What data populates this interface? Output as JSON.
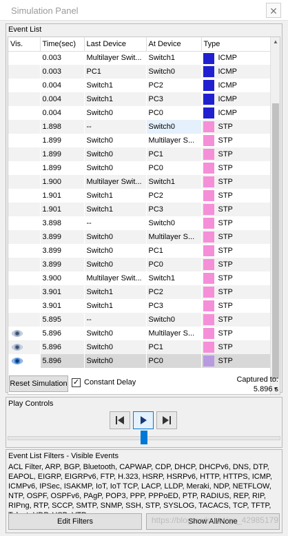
{
  "window": {
    "title": "Simulation Panel",
    "close_label": "✕"
  },
  "event_list": {
    "section_label": "Event List",
    "columns": [
      "Vis.",
      "Time(sec)",
      "Last Device",
      "At Device",
      "Type"
    ],
    "rows": [
      {
        "vis": "",
        "time": "0.003",
        "last": "Multilayer Swit...",
        "at": "Switch1",
        "type": "ICMP",
        "color": "#2020d0"
      },
      {
        "vis": "",
        "time": "0.003",
        "last": "PC1",
        "at": "Switch0",
        "type": "ICMP",
        "color": "#2020d0"
      },
      {
        "vis": "",
        "time": "0.004",
        "last": "Switch1",
        "at": "PC2",
        "type": "ICMP",
        "color": "#2020d0"
      },
      {
        "vis": "",
        "time": "0.004",
        "last": "Switch1",
        "at": "PC3",
        "type": "ICMP",
        "color": "#2020d0"
      },
      {
        "vis": "",
        "time": "0.004",
        "last": "Switch0",
        "at": "PC0",
        "type": "ICMP",
        "color": "#2020d0"
      },
      {
        "vis": "",
        "time": "1.898",
        "last": "--",
        "at": "Switch0",
        "type": "STP",
        "color": "#f58fd8"
      },
      {
        "vis": "",
        "time": "1.899",
        "last": "Switch0",
        "at": "Multilayer S...",
        "type": "STP",
        "color": "#f58fd8"
      },
      {
        "vis": "",
        "time": "1.899",
        "last": "Switch0",
        "at": "PC1",
        "type": "STP",
        "color": "#f58fd8"
      },
      {
        "vis": "",
        "time": "1.899",
        "last": "Switch0",
        "at": "PC0",
        "type": "STP",
        "color": "#f58fd8"
      },
      {
        "vis": "",
        "time": "1.900",
        "last": "Multilayer Swit...",
        "at": "Switch1",
        "type": "STP",
        "color": "#f58fd8"
      },
      {
        "vis": "",
        "time": "1.901",
        "last": "Switch1",
        "at": "PC2",
        "type": "STP",
        "color": "#f58fd8"
      },
      {
        "vis": "",
        "time": "1.901",
        "last": "Switch1",
        "at": "PC3",
        "type": "STP",
        "color": "#f58fd8"
      },
      {
        "vis": "",
        "time": "3.898",
        "last": "--",
        "at": "Switch0",
        "type": "STP",
        "color": "#f58fd8"
      },
      {
        "vis": "",
        "time": "3.899",
        "last": "Switch0",
        "at": "Multilayer S...",
        "type": "STP",
        "color": "#f58fd8"
      },
      {
        "vis": "",
        "time": "3.899",
        "last": "Switch0",
        "at": "PC1",
        "type": "STP",
        "color": "#f58fd8"
      },
      {
        "vis": "",
        "time": "3.899",
        "last": "Switch0",
        "at": "PC0",
        "type": "STP",
        "color": "#f58fd8"
      },
      {
        "vis": "",
        "time": "3.900",
        "last": "Multilayer Swit...",
        "at": "Switch1",
        "type": "STP",
        "color": "#f58fd8"
      },
      {
        "vis": "",
        "time": "3.901",
        "last": "Switch1",
        "at": "PC2",
        "type": "STP",
        "color": "#f58fd8"
      },
      {
        "vis": "",
        "time": "3.901",
        "last": "Switch1",
        "at": "PC3",
        "type": "STP",
        "color": "#f58fd8"
      },
      {
        "vis": "",
        "time": "5.895",
        "last": "--",
        "at": "Switch0",
        "type": "STP",
        "color": "#f58fd8"
      },
      {
        "vis": "eye",
        "time": "5.896",
        "last": "Switch0",
        "at": "Multilayer S...",
        "type": "STP",
        "color": "#f58fd8"
      },
      {
        "vis": "eye",
        "time": "5.896",
        "last": "Switch0",
        "at": "PC1",
        "type": "STP",
        "color": "#f58fd8"
      },
      {
        "vis": "eye-blue",
        "time": "5.896",
        "last": "Switch0",
        "at": "PC0",
        "type": "STP",
        "color": "#b89ae0"
      }
    ]
  },
  "controls": {
    "reset_label": "Reset Simulation",
    "constant_delay_label": "Constant Delay",
    "constant_delay_checked": "✓",
    "captured_label": "Captured to:",
    "captured_value": "5.896 s"
  },
  "play": {
    "section_label": "Play Controls",
    "buttons": [
      "back-icon",
      "play-icon",
      "forward-icon"
    ],
    "slider_position": 0.5
  },
  "filters": {
    "section_label": "Event List Filters - Visible Events",
    "list": "ACL Filter, ARP, BGP, Bluetooth, CAPWAP, CDP, DHCP, DHCPv6, DNS, DTP, EAPOL, EIGRP, EIGRPv6, FTP, H.323, HSRP, HSRPv6, HTTP, HTTPS, ICMP, ICMPv6, IPSec, ISAKMP, IoT, IoT TCP, LACP, LLDP, Meraki, NDP, NETFLOW, NTP, OSPF, OSPFv6, PAgP, POP3, PPP, PPPoED, PTP, RADIUS, REP, RIP, RIPng, RTP, SCCP, SMTP, SNMP, SSH, STP, SYSLOG, TACACS, TCP, TFTP, Telnet, UDP, USB, VTP",
    "edit_label": "Edit Filters",
    "show_all_label": "Show All/None"
  },
  "watermark": "https://blog.csdn.net/qq_42985179"
}
